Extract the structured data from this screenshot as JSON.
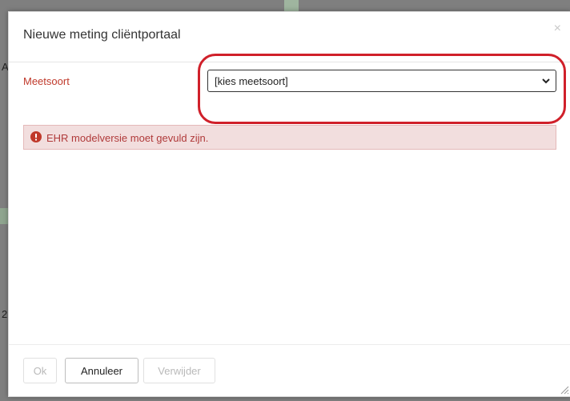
{
  "background": {
    "left_chars": [
      "A",
      "2"
    ]
  },
  "dialog": {
    "title": "Nieuwe meting cliëntportaal",
    "close_glyph": "×",
    "field": {
      "label": "Meetsoort",
      "selected_value": "[kies meetsoort]",
      "icon": "chevron-down-icon"
    },
    "alert": {
      "icon": "exclamation-circle-icon",
      "message": "EHR modelversie moet gevuld zijn."
    },
    "buttons": {
      "ok": "Ok",
      "cancel": "Annuleer",
      "delete": "Verwijder"
    }
  },
  "colors": {
    "label_red": "#c0392b",
    "alert_bg": "#f2dede",
    "alert_text": "#b03a3a",
    "highlight": "#d0202a"
  }
}
